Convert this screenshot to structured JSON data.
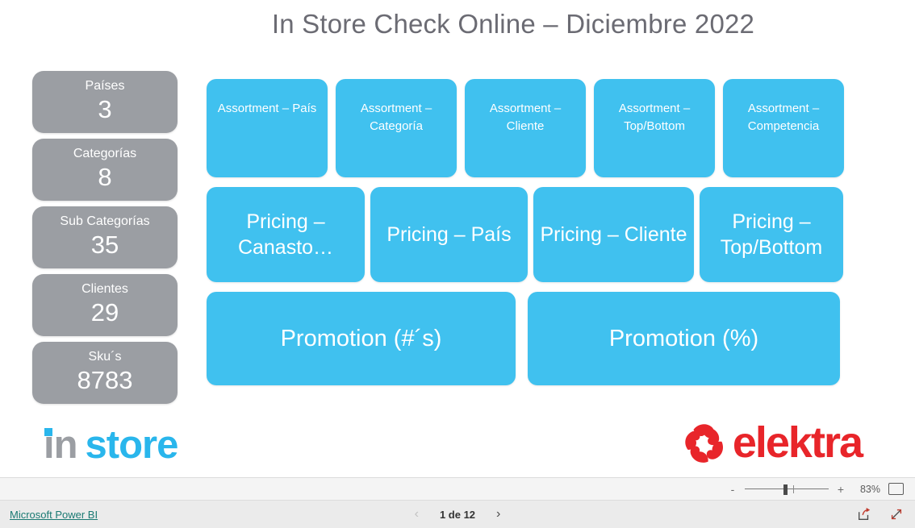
{
  "report": {
    "title": "In Store Check Online – Diciembre 2022",
    "accent_blue": "#40c1ef",
    "kpi_grey": "#9b9ea3",
    "title_color": "#6b6b73"
  },
  "kpis": [
    {
      "label": "Países",
      "value": "3"
    },
    {
      "label": "Categorías",
      "value": "8"
    },
    {
      "label": "Sub Categorías",
      "value": "35"
    },
    {
      "label": "Clientes",
      "value": "29"
    },
    {
      "label": "Sku´s",
      "value": "8783"
    }
  ],
  "tiles": {
    "assortment": [
      {
        "label": "Assortment – País"
      },
      {
        "label": "Assortment – Categoría"
      },
      {
        "label": "Assortment – Cliente"
      },
      {
        "label": "Assortment – Top/Bottom"
      },
      {
        "label": "Assortment – Competencia"
      }
    ],
    "pricing": [
      {
        "label": "Pricing – Canasto…"
      },
      {
        "label": "Pricing – País"
      },
      {
        "label": "Pricing – Cliente"
      },
      {
        "label": "Pricing – Top/Bottom"
      }
    ],
    "promotion": [
      {
        "label": "Promotion (#´s)"
      },
      {
        "label": "Promotion (%)"
      }
    ]
  },
  "logos": {
    "instore_first": "in",
    "instore_second": "store",
    "elektra_word": "elektra",
    "instore_grey": "#9b9ea3",
    "instore_blue": "#29b6ec",
    "elektra_red": "#e8252a"
  },
  "footer": {
    "zoom_out": "-",
    "zoom_in": "+",
    "zoom_percent": "83%",
    "fit_icon": "fit-to-screen-icon",
    "powerbi_link": "Microsoft Power BI",
    "prev_chevron": "‹",
    "next_chevron": "›",
    "page_indicator": "1 de 12",
    "share_icon": "share-icon",
    "fullscreen_icon": "fullscreen-icon"
  }
}
